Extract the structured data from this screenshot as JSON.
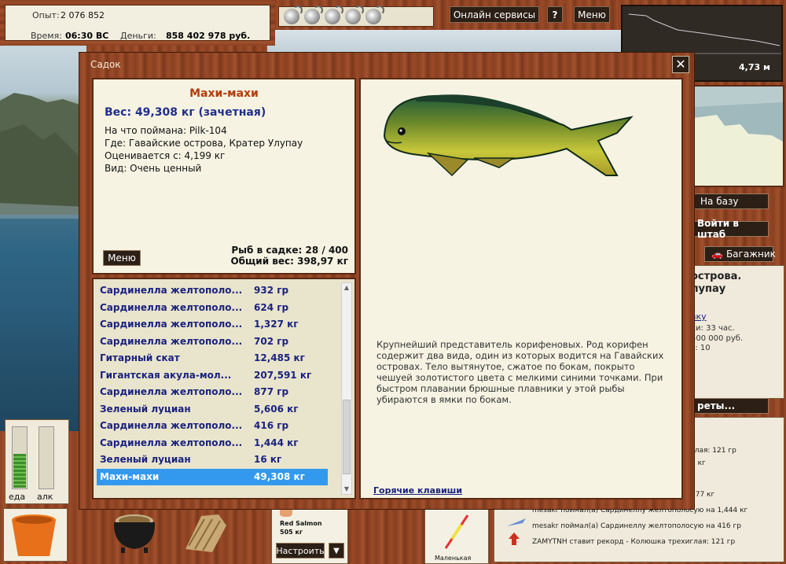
{
  "stats": {
    "exp_label": "Опыт:",
    "exp_value": "2 076 852",
    "time_label": "Время:",
    "time_value": "06:30 ВС",
    "money_label": "Деньги:",
    "money_value": "858 402 978 руб."
  },
  "topbar": {
    "online_label": "Онлайн сервисы",
    "help_label": "?",
    "menu_label": "Меню"
  },
  "minimap": {
    "distance": "4,73 м"
  },
  "right_buttons": {
    "base_label": "На базу",
    "hq_label": "Войти в штаб",
    "trunk_label": "Багажник"
  },
  "right_info": {
    "line1": "острова.",
    "line2": "лупау",
    "link": "вку",
    "line3": "ки: 33 час.",
    "line4": "500 000 руб.",
    "line5": "з: 10",
    "btn": "реты..."
  },
  "chat": {
    "lines": [
      "глая: 121 гр",
      "5 кг",
      "177 кг",
      "mesakr поймал(а) Сардинеллу желтополосую на 1,444 кг",
      "mesakr поймал(а) Сардинеллу желтополосую на 416 гр",
      "ZAMYTNH ставит рекорд - Колюшка трехиглая: 121 гр"
    ]
  },
  "gauges": {
    "food_label": "еда",
    "alcohol_label": "алк",
    "food_level": 0.55,
    "alcohol_level": 0.0
  },
  "lure": {
    "name": "Red Salmon",
    "weight": "505 кг",
    "setup_label": "Настроить",
    "size_label": "Маленькая"
  },
  "dialog": {
    "title": "Садок",
    "close": "✕",
    "fish": {
      "name": "Махи-махи",
      "weight": "Вес: 49,308 кг (зачетная)",
      "caught_with": "На что поймана: Pilk-104",
      "location": "Где: Гавайские острова, Кратер Улупау",
      "valued_from": "Оценивается с: 4,199 кг",
      "kind": "Вид: Очень ценный"
    },
    "menu_label": "Меню",
    "cage_count": "Рыб в садке: 28 / 400",
    "total_weight": "Общий вес: 398,97 кг",
    "catch_list": [
      {
        "name": "Сардинелла желтополо...",
        "weight": "932 гр"
      },
      {
        "name": "Сардинелла желтополо...",
        "weight": "624 гр"
      },
      {
        "name": "Сардинелла желтополо...",
        "weight": "1,327 кг"
      },
      {
        "name": "Сардинелла желтополо...",
        "weight": "702 гр"
      },
      {
        "name": "Гитарный скат",
        "weight": "12,485 кг"
      },
      {
        "name": "Гигантская акула-мол...",
        "weight": "207,591 кг"
      },
      {
        "name": "Сардинелла желтополо...",
        "weight": "877 гр"
      },
      {
        "name": "Зеленый луциан",
        "weight": "5,606 кг"
      },
      {
        "name": "Сардинелла желтополо...",
        "weight": "416 гр"
      },
      {
        "name": "Сардинелла желтополо...",
        "weight": "1,444 кг"
      },
      {
        "name": "Зеленый луциан",
        "weight": "16 кг"
      },
      {
        "name": "Махи-махи",
        "weight": "49,308 кг"
      }
    ],
    "description": "Крупнейший представитель корифеновых. Род корифен содержит два вида, один из которых водится на Гавайских островах. Тело вытянутое, сжатое по бокам, покрыто чешуей золотистого цвета с мелкими синими точками. При быстром плавании брюшные плавники у этой рыбы убираются в ямки по бокам.",
    "hotkeys": "Горячие клавиши"
  }
}
